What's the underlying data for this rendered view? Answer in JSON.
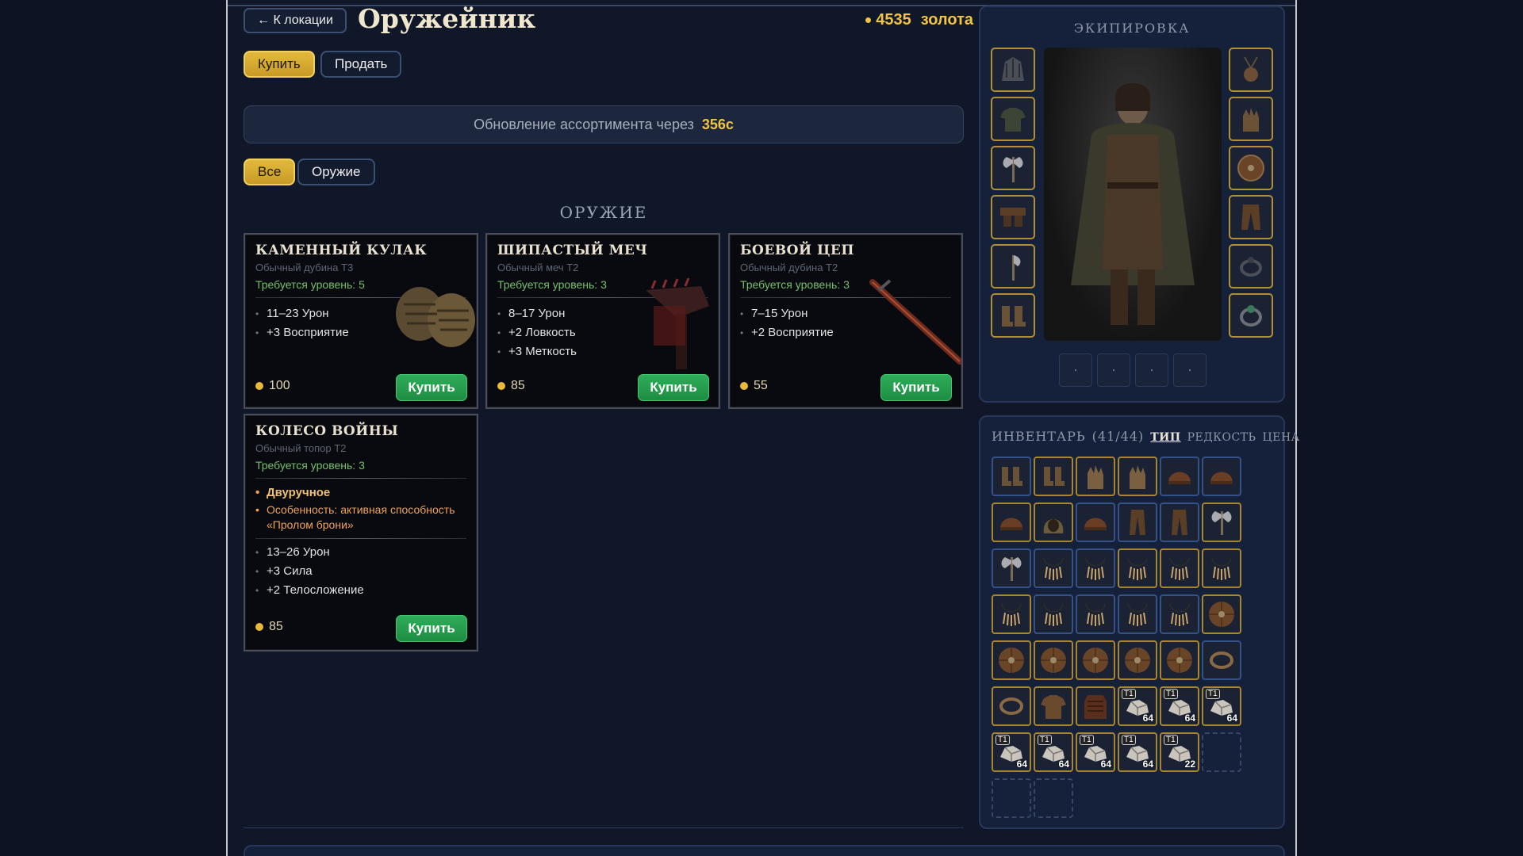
{
  "header": {
    "back_label": "← К локации",
    "title": "Оружейник",
    "gold_amount": "4535",
    "gold_label": "золота"
  },
  "mode_tabs": [
    {
      "label": "Купить",
      "active": true
    },
    {
      "label": "Продать",
      "active": false
    }
  ],
  "refresh": {
    "label": "Обновление ассортимента через",
    "time": "356с"
  },
  "filters": [
    {
      "label": "Все",
      "active": true
    },
    {
      "label": "Оружие",
      "active": false
    }
  ],
  "section_title": "ОРУЖИЕ",
  "shop_items": [
    {
      "name": "КАМЕННЫЙ КУЛАК",
      "subtitle": "Обычный дубина Т3",
      "requirement": "Требуется уровень: 5",
      "stats": [
        "11–23 Урон",
        "+3 Восприятие"
      ],
      "price": "100",
      "buy_label": "Купить",
      "icon": "stone-fist-icon"
    },
    {
      "name": "ШИПАСТЫЙ МЕЧ",
      "subtitle": "Обычный меч Т2",
      "requirement": "Требуется уровень: 3",
      "stats": [
        "8–17 Урон",
        "+2 Ловкость",
        "+3 Меткость"
      ],
      "price": "85",
      "buy_label": "Купить",
      "icon": "spiked-sword-icon"
    },
    {
      "name": "БОЕВОЙ ЦЕП",
      "subtitle": "Обычный дубина Т2",
      "requirement": "Требуется уровень: 3",
      "stats": [
        "7–15 Урон",
        "+2 Восприятие"
      ],
      "price": "55",
      "buy_label": "Купить",
      "icon": "flail-icon"
    },
    {
      "name": "КОЛЕСО ВОЙНЫ",
      "subtitle": "Обычный топор Т2",
      "requirement": "Требуется уровень: 3",
      "specials": [
        "Двуручное",
        "Особенность: активная способность «Пролом брони»"
      ],
      "stats": [
        "13–26 Урон",
        "+3 Сила",
        "+2 Телосложение"
      ],
      "price": "85",
      "buy_label": "Купить",
      "icon": "war-wheel-icon"
    }
  ],
  "equipment": {
    "title": "ЭКИПИРОВКА",
    "left_slots": [
      "helmet-icon",
      "shirt-icon",
      "axe-icon",
      "belt-icon",
      "axe-icon",
      "boots-icon"
    ],
    "right_slots": [
      "amulet-icon",
      "gloves-icon",
      "shield-icon",
      "pants-icon",
      "ring-icon",
      "ring-icon"
    ],
    "quick_slots": 4
  },
  "inventory": {
    "title": "ИНВЕНТАРЬ",
    "count": "(41/44)",
    "sort_options": [
      {
        "label": "ТИП",
        "active": true
      },
      {
        "label": "РЕДКОСТЬ",
        "active": false
      },
      {
        "label": "ЦЕНА",
        "active": false
      }
    ],
    "items": [
      {
        "icon": "boots-icon",
        "rarity": "blue"
      },
      {
        "icon": "boots-icon",
        "rarity": "gold"
      },
      {
        "icon": "gloves-icon",
        "rarity": "gold"
      },
      {
        "icon": "gloves-icon",
        "rarity": "gold"
      },
      {
        "icon": "helmet-icon",
        "rarity": "blue"
      },
      {
        "icon": "helmet-icon",
        "rarity": "blue"
      },
      {
        "icon": "helmet-icon",
        "rarity": "gold"
      },
      {
        "icon": "hood-icon",
        "rarity": "gold"
      },
      {
        "icon": "helmet-icon",
        "rarity": "blue"
      },
      {
        "icon": "pants-icon",
        "rarity": "blue"
      },
      {
        "icon": "pants-icon",
        "rarity": "blue"
      },
      {
        "icon": "axe-icon",
        "rarity": "gold"
      },
      {
        "icon": "axe-icon",
        "rarity": "blue"
      },
      {
        "icon": "necklace-icon",
        "rarity": "blue"
      },
      {
        "icon": "necklace-icon",
        "rarity": "blue"
      },
      {
        "icon": "necklace-icon",
        "rarity": "gold"
      },
      {
        "icon": "necklace-icon",
        "rarity": "gold"
      },
      {
        "icon": "necklace-icon",
        "rarity": "gold"
      },
      {
        "icon": "necklace-icon",
        "rarity": "gold"
      },
      {
        "icon": "necklace-icon",
        "rarity": "blue"
      },
      {
        "icon": "necklace-icon",
        "rarity": "blue"
      },
      {
        "icon": "necklace-icon",
        "rarity": "blue"
      },
      {
        "icon": "necklace-icon",
        "rarity": "blue"
      },
      {
        "icon": "shield-icon",
        "rarity": "gold"
      },
      {
        "icon": "shield-icon",
        "rarity": "gold"
      },
      {
        "icon": "shield-icon",
        "rarity": "gold"
      },
      {
        "icon": "shield-icon",
        "rarity": "gold"
      },
      {
        "icon": "shield-icon",
        "rarity": "gold"
      },
      {
        "icon": "shield-icon",
        "rarity": "gold"
      },
      {
        "icon": "ring-icon",
        "rarity": "blue"
      },
      {
        "icon": "ring-icon",
        "rarity": "gold"
      },
      {
        "icon": "shirt-icon",
        "rarity": "gold"
      },
      {
        "icon": "armor-icon",
        "rarity": "gold"
      },
      {
        "icon": "ore-icon",
        "rarity": "gold",
        "tier": "T1",
        "qty": "64"
      },
      {
        "icon": "ore-icon",
        "rarity": "gold",
        "tier": "T1",
        "qty": "64"
      },
      {
        "icon": "ore-icon",
        "rarity": "gold",
        "tier": "T1",
        "qty": "64"
      },
      {
        "icon": "ore-icon",
        "rarity": "gold",
        "tier": "T1",
        "qty": "64"
      },
      {
        "icon": "ore-icon",
        "rarity": "gold",
        "tier": "T1",
        "qty": "64"
      },
      {
        "icon": "ore-icon",
        "rarity": "gold",
        "tier": "T1",
        "qty": "64"
      },
      {
        "icon": "ore-icon",
        "rarity": "gold",
        "tier": "T1",
        "qty": "64"
      },
      {
        "icon": "ore-icon",
        "rarity": "gold",
        "tier": "T1",
        "qty": "22"
      }
    ],
    "empty_slots": 3
  }
}
